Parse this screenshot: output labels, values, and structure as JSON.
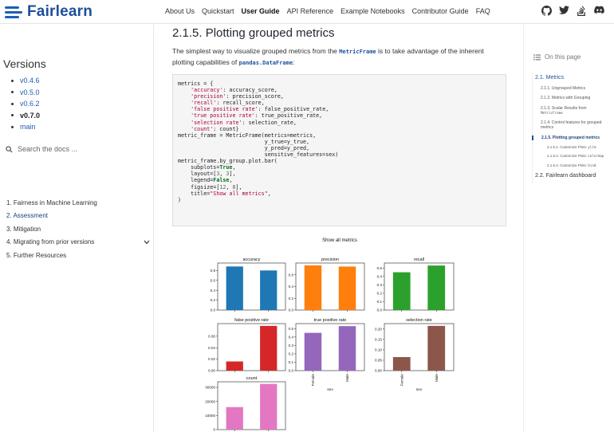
{
  "header": {
    "logo_text": "Fairlearn",
    "brand_color": "#1e5eb6",
    "nav": [
      {
        "label": "About Us",
        "active": false
      },
      {
        "label": "Quickstart",
        "active": false
      },
      {
        "label": "User Guide",
        "active": true
      },
      {
        "label": "API Reference",
        "active": false
      },
      {
        "label": "Example Notebooks",
        "active": false
      },
      {
        "label": "Contributor Guide",
        "active": false
      },
      {
        "label": "FAQ",
        "active": false
      }
    ],
    "icons": [
      "github-icon",
      "twitter-icon",
      "stackoverflow-icon",
      "discord-icon"
    ]
  },
  "sidebar": {
    "versions_title": "Versions",
    "versions": [
      {
        "label": "v0.4.6",
        "current": false
      },
      {
        "label": "v0.5.0",
        "current": false
      },
      {
        "label": "v0.6.2",
        "current": false
      },
      {
        "label": "v0.7.0",
        "current": true
      },
      {
        "label": "main",
        "current": false
      }
    ],
    "search_placeholder": "Search the docs ...",
    "toc": [
      {
        "label": "1. Fairness in Machine Learning",
        "active": false,
        "expandable": false
      },
      {
        "label": "2. Assessment",
        "active": true,
        "expandable": false
      },
      {
        "label": "3. Mitigation",
        "active": false,
        "expandable": false
      },
      {
        "label": "4. Migrating from prior versions",
        "active": false,
        "expandable": true
      },
      {
        "label": "5. Further Resources",
        "active": false,
        "expandable": false
      }
    ]
  },
  "main": {
    "title": "2.1.5. Plotting grouped metrics",
    "intro_before": "The simplest way to visualize grouped metrics from the ",
    "intro_code1": "MetricFrame",
    "intro_middle": " is to take advantage of the inherent plotting capabilities of ",
    "intro_code2": "pandas.DataFrame",
    "intro_after": ":"
  },
  "right_toc": {
    "on_this_page": "On this page",
    "items": [
      {
        "label": "2.1. Metrics",
        "level": 1,
        "active": true
      },
      {
        "label": "2.1.1. Ungrouped Metrics",
        "level": 2
      },
      {
        "label": "2.1.2. Metrics with Grouping",
        "level": 2
      },
      {
        "label": "2.1.3. Scalar Results from ",
        "mono": "MetricFrame",
        "level": 2
      },
      {
        "label": "2.1.4. Control features for grouped metrics",
        "level": 2
      },
      {
        "label": "2.1.5. Plotting grouped metrics",
        "level": 2,
        "current": true
      },
      {
        "label": "2.1.5.1. Customize Plots: ",
        "mono": "ylim",
        "level": 3
      },
      {
        "label": "2.1.5.2. Customize Plots: ",
        "mono": "colormap",
        "level": 3
      },
      {
        "label": "2.1.5.3. Customize Plots: ",
        "mono": "kind",
        "level": 3
      },
      {
        "label": "2.2. Fairlearn dashboard",
        "level": 1
      }
    ]
  },
  "chart_data": {
    "type": "bar",
    "title": "Show all metrics",
    "categories": [
      "Female",
      "Male"
    ],
    "xlabel": "sex",
    "subplots": [
      {
        "title": "accuracy",
        "values": [
          0.88,
          0.8
        ],
        "ylim": [
          0,
          0.95
        ],
        "yticks": [
          0.0,
          0.2,
          0.4,
          0.6,
          0.8
        ],
        "color": "#1f77b4"
      },
      {
        "title": "precision",
        "values": [
          0.76,
          0.74
        ],
        "ylim": [
          0,
          0.8
        ],
        "yticks": [
          0.0,
          0.2,
          0.4,
          0.6
        ],
        "color": "#ff7f0e"
      },
      {
        "title": "recall",
        "values": [
          0.45,
          0.53
        ],
        "ylim": [
          0,
          0.56
        ],
        "yticks": [
          0.0,
          0.1,
          0.2,
          0.3,
          0.4,
          0.5
        ],
        "color": "#2ca02c"
      },
      {
        "title": "false positive rate",
        "values": [
          0.016,
          0.078
        ],
        "ylim": [
          0,
          0.082
        ],
        "yticks": [
          0.0,
          0.02,
          0.04,
          0.06
        ],
        "color": "#d62728"
      },
      {
        "title": "true positive rate",
        "values": [
          0.45,
          0.53
        ],
        "ylim": [
          0,
          0.56
        ],
        "yticks": [
          0.0,
          0.1,
          0.2,
          0.3,
          0.4,
          0.5
        ],
        "color": "#9467bd"
      },
      {
        "title": "selection rate",
        "values": [
          0.065,
          0.215
        ],
        "ylim": [
          0,
          0.226
        ],
        "yticks": [
          0.0,
          0.05,
          0.1,
          0.15,
          0.2
        ],
        "color": "#8c564b"
      },
      {
        "title": "count",
        "values": [
          16000,
          32500
        ],
        "ylim": [
          0,
          34000
        ],
        "yticks": [
          0,
          10000,
          20000,
          30000
        ],
        "color": "#e377c2"
      }
    ]
  }
}
